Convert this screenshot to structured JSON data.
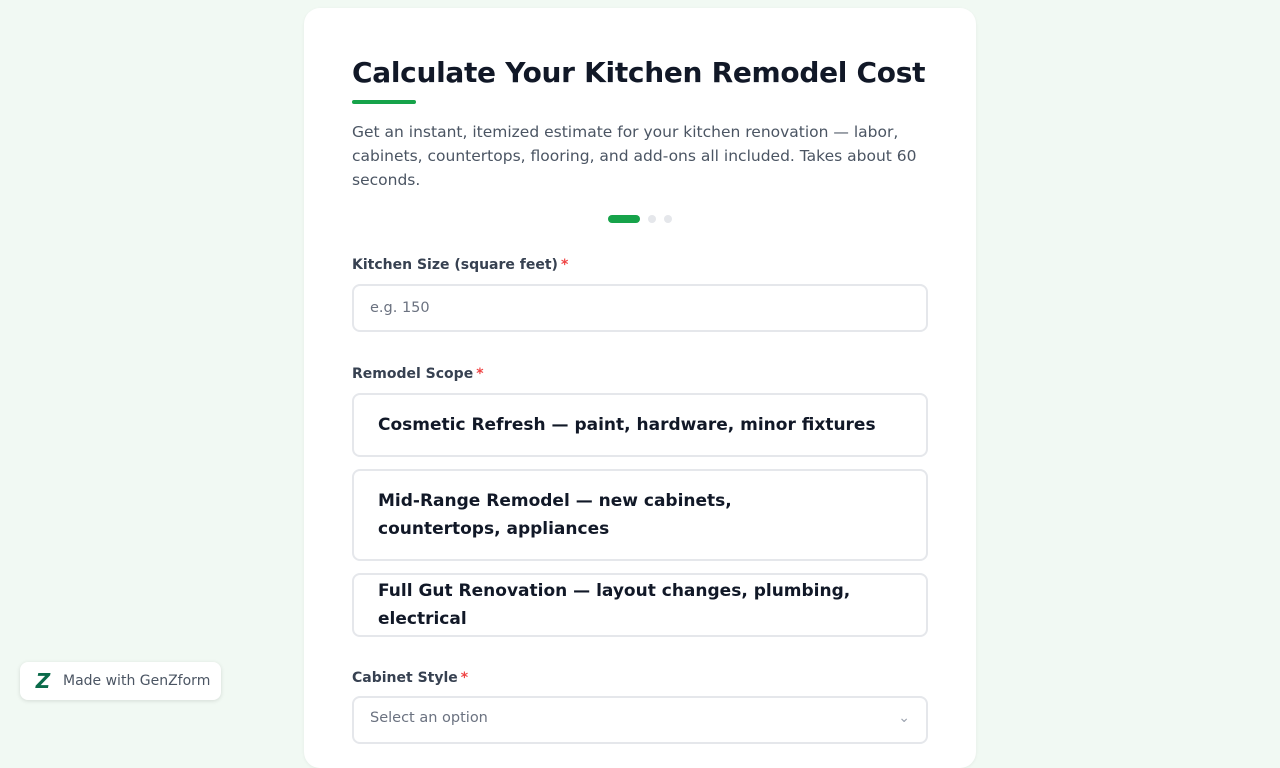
{
  "form": {
    "title": "Calculate Your Kitchen Remodel Cost",
    "description": "Get an instant, itemized estimate for your kitchen renovation — labor, cabinets, countertops, flooring, and add-ons all included. Takes about 60 seconds.",
    "progress": {
      "current_step": 1,
      "total_steps": 3
    },
    "kitchen_size": {
      "label": "Kitchen Size (square feet)",
      "required_mark": "*",
      "placeholder": "e.g. 150",
      "value": ""
    },
    "remodel_scope": {
      "label": "Remodel Scope",
      "required_mark": "*",
      "options": [
        "Cosmetic Refresh — paint, hardware, minor fixtures",
        "Mid-Range Remodel — new cabinets, countertops, appliances",
        "Full Gut Renovation — layout changes, plumbing, electrical"
      ]
    },
    "cabinet_style": {
      "label": "Cabinet Style",
      "required_mark": "*",
      "placeholder": "Select an option"
    }
  },
  "badge": {
    "logo_letter": "Z",
    "text": "Made with GenZform"
  },
  "colors": {
    "accent": "#16a34a",
    "page_background": "#f1f9f3",
    "required": "#ef4444"
  },
  "icons": {
    "select_chevron": "chevron-down-icon",
    "brand_logo": "genzform-logo-icon"
  }
}
